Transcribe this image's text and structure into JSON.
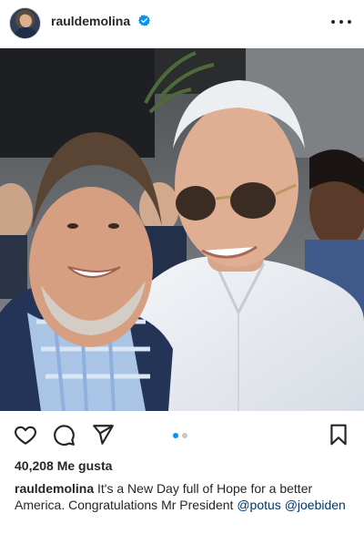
{
  "header": {
    "username": "rauldemolina",
    "verified": true,
    "more_icon": "more-horizontal-icon"
  },
  "photo": {
    "slides": 2,
    "active_slide": 1
  },
  "actions": {
    "like_icon": "heart-icon",
    "comment_icon": "comment-bubble-icon",
    "share_icon": "send-paper-plane-icon",
    "save_icon": "bookmark-icon"
  },
  "likes_text": "40,208 Me gusta",
  "caption": {
    "username": "rauldemolina",
    "text": "It's a New Day full of Hope for a better America.  Congratulations Mr President ",
    "mentions": [
      "@potus",
      "@joebiden"
    ]
  },
  "colors": {
    "verified_blue": "#0095f6",
    "mention_blue": "#00376b",
    "active_dot": "#0095f6"
  }
}
